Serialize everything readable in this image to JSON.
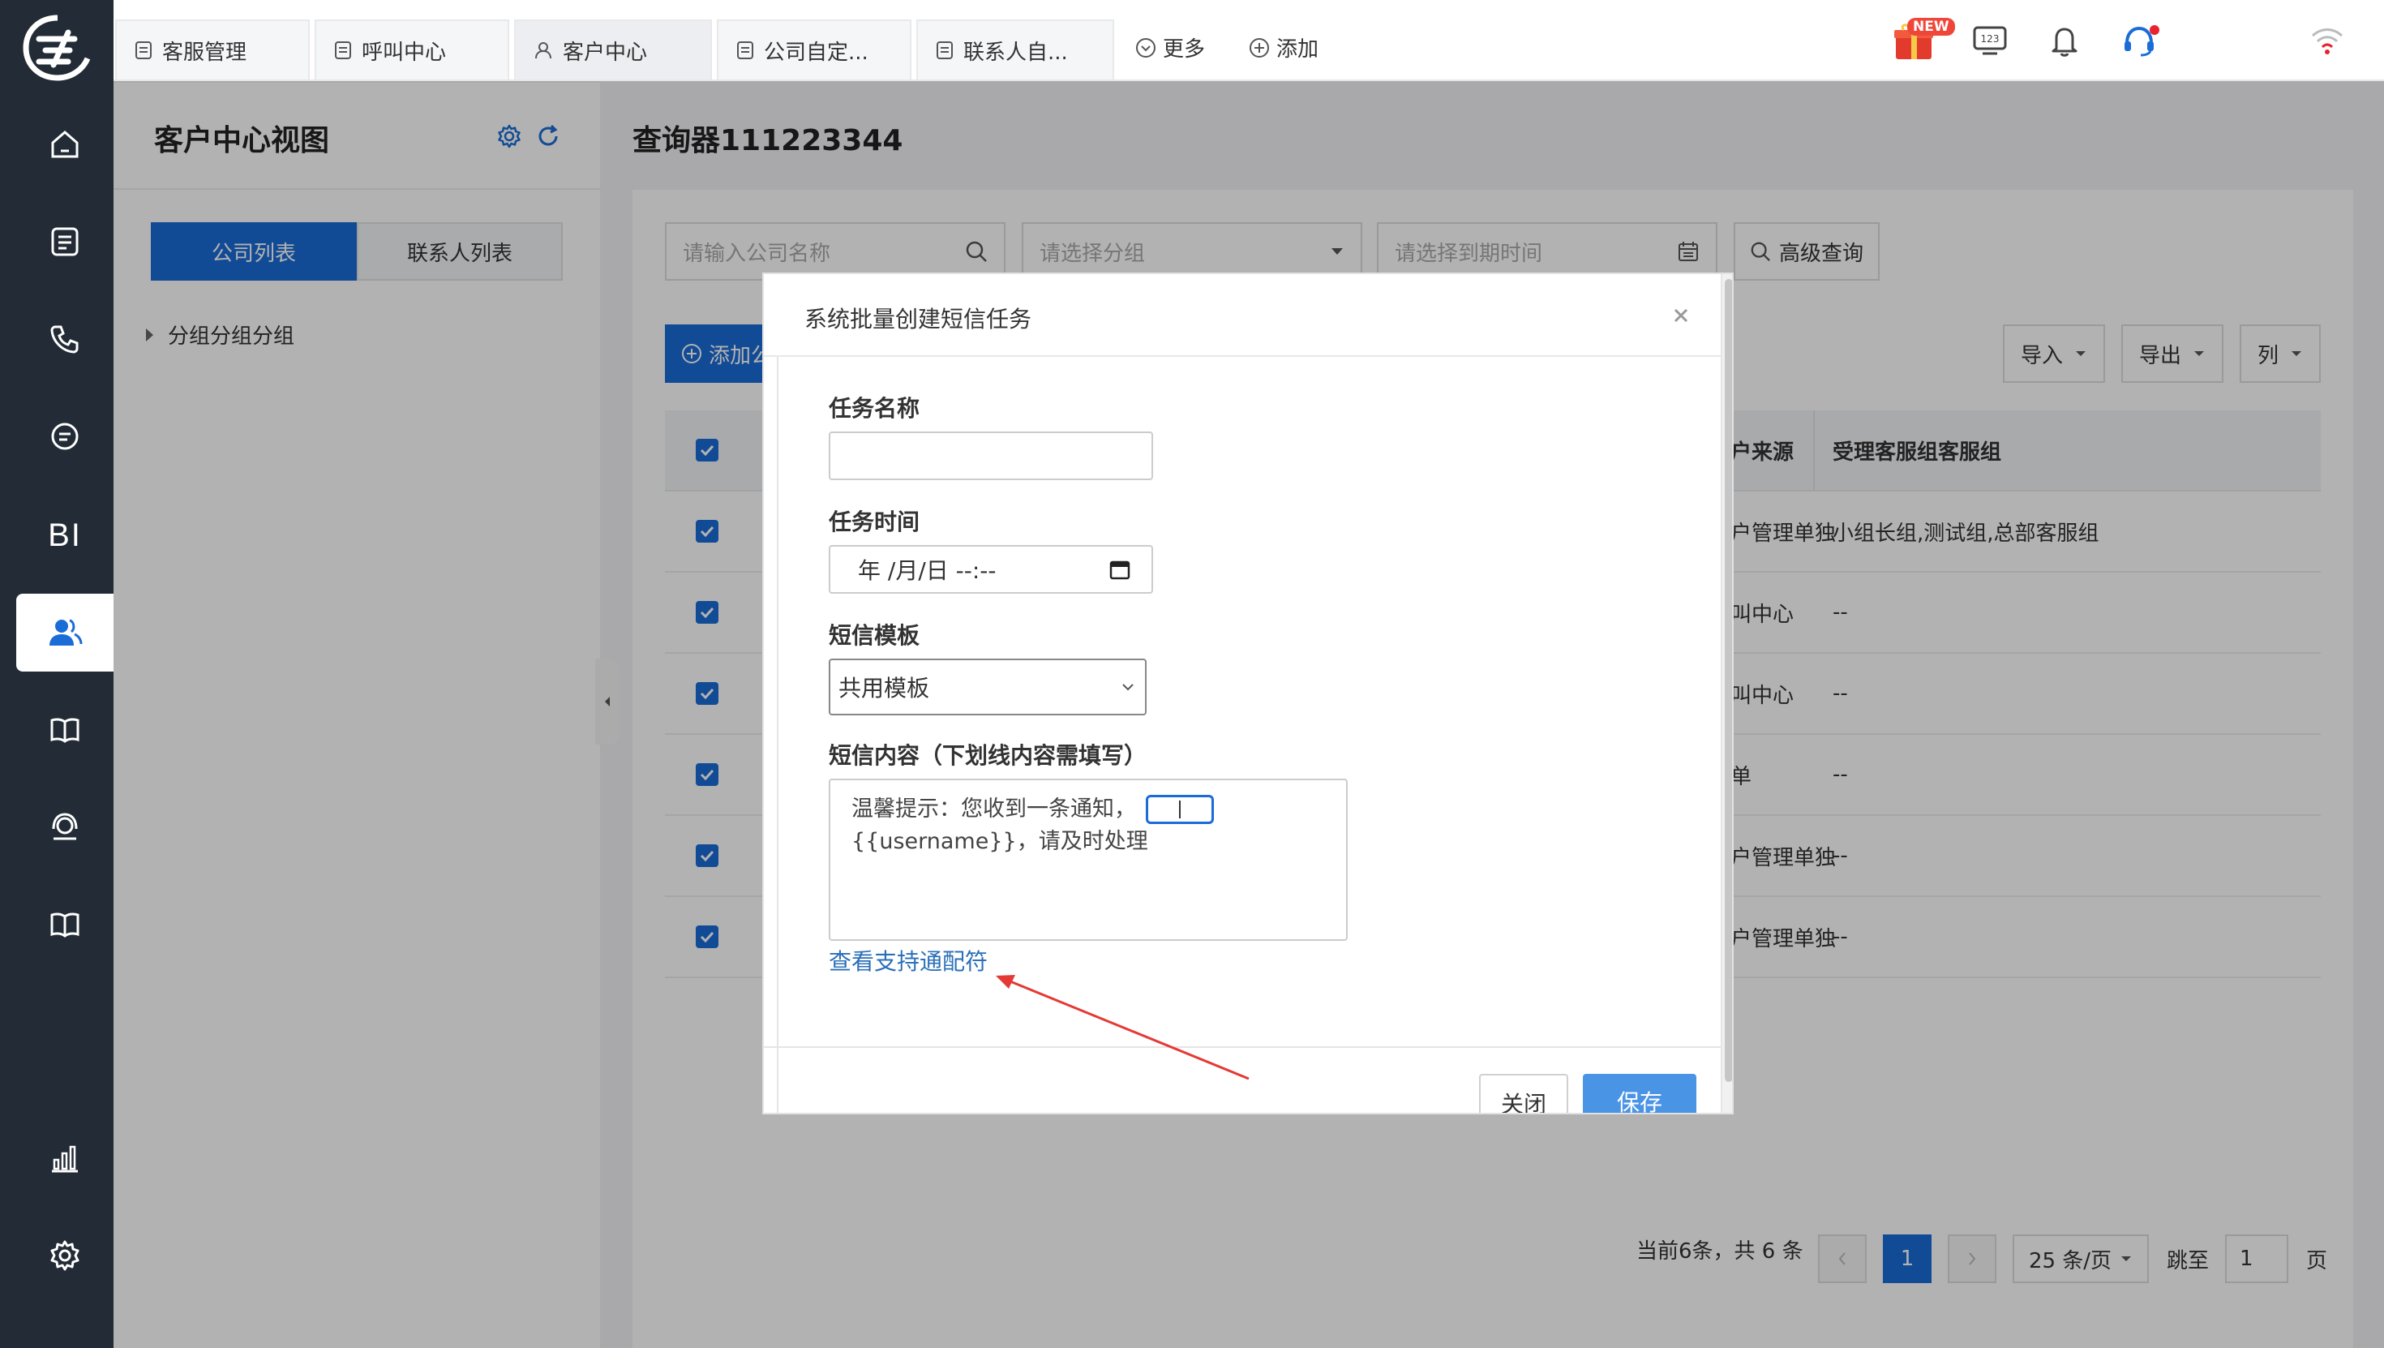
{
  "top_tabs": [
    {
      "label": "客服管理",
      "active": false
    },
    {
      "label": "呼叫中心",
      "active": false
    },
    {
      "label": "客户中心",
      "active": true
    },
    {
      "label": "公司自定...",
      "active": false
    },
    {
      "label": "联系人自...",
      "active": false
    }
  ],
  "top_links": {
    "more": "更多",
    "add": "添加"
  },
  "top_icons": {
    "new_badge": "NEW",
    "keypad_label": "123"
  },
  "left_nav": {
    "bi_label": "BI"
  },
  "left_panel": {
    "title": "客户中心视图",
    "seg_company": "公司列表",
    "seg_contact": "联系人列表",
    "tree_item": "分组分组分组"
  },
  "main": {
    "title": "查询器111223344",
    "search_placeholder": "请输入公司名称",
    "group_placeholder": "请选择分组",
    "date_placeholder": "请选择到期时间",
    "advanced_query": "高级查询",
    "add_button": "添加公",
    "import": "导入",
    "export": "导出",
    "columns": "列",
    "table": {
      "headers": [
        "客户来源",
        "受理客服组客服组"
      ],
      "rows": [
        [
          "客户管理单独",
          "小组长组,测试组,总部客服组"
        ],
        [
          "呼叫中心",
          "--"
        ],
        [
          "呼叫中心",
          "--"
        ],
        [
          "工单",
          "--"
        ],
        [
          "客户管理单独",
          "--"
        ],
        [
          "客户管理单独",
          "--"
        ]
      ]
    },
    "pager": {
      "summary": "当前6条，共 6 条",
      "current_page": "1",
      "page_size": "25 条/页",
      "jump_label": "跳至",
      "jump_value": "1",
      "page_suffix": "页"
    }
  },
  "modal": {
    "title": "系统批量创建短信任务",
    "task_name_label": "任务名称",
    "task_name_value": "",
    "task_time_label": "任务时间",
    "task_time_value": "年 /月/日 --:--",
    "template_label": "短信模板",
    "template_value": "共用模板",
    "content_label": "短信内容（下划线内容需填写）",
    "content_line1": "温馨提示：您收到一条通知，",
    "content_line2": "{{username}}，请及时处理",
    "wildcard_link": "查看支持通配符",
    "close_button": "关闭",
    "save_button": "保存"
  },
  "colors": {
    "nav_bg": "#222b36",
    "primary": "#1a6cd6",
    "save_button": "#4a94e6",
    "annotation_arrow": "#e53935"
  }
}
